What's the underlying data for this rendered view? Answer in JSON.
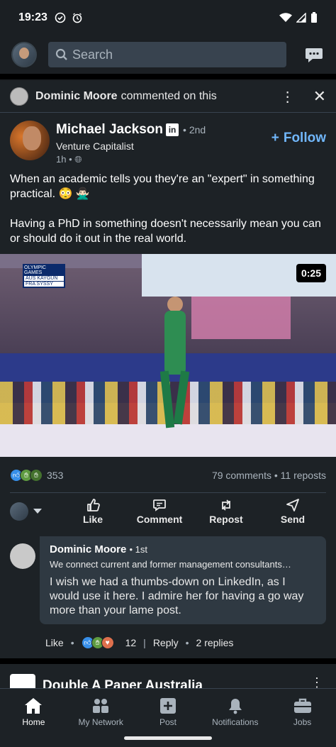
{
  "status": {
    "time": "19:23"
  },
  "search": {
    "placeholder": "Search"
  },
  "context": {
    "actor": "Dominic Moore",
    "action": "commented on this"
  },
  "post": {
    "author": "Michael Jackson",
    "degree": "• 2nd",
    "headline": "Venture Capitalist",
    "time": "1h •",
    "follow_label": "Follow",
    "text_p1": "When an academic tells you they're an \"expert\" in something practical. 😳 🙅🏻‍♂️",
    "text_p2": "Having a PhD in something doesn't necessarily mean you can or should do it out in the real world.",
    "video_duration": "0:25",
    "video_caption_top": "OLYMPIC GAMES",
    "video_row1": "AUS KAYGUN",
    "video_row2": "FRA SYSSY"
  },
  "social": {
    "reactions": "353",
    "comments_reposts": "79 comments • 11 reposts"
  },
  "actions": {
    "like": "Like",
    "comment": "Comment",
    "repost": "Repost",
    "send": "Send"
  },
  "comment": {
    "name": "Dominic Moore",
    "degree": "• 1st",
    "headline": "We connect current and former management consultants…",
    "text": "I wish we had a thumbs-down on LinkedIn, as I would use it here.    I admire her for having a go way more than your lame post.",
    "like": "Like",
    "reactions": "12",
    "reply": "Reply",
    "replies": "2 replies"
  },
  "next_post": {
    "name": "Double A Paper Australia"
  },
  "nav": {
    "home": "Home",
    "network": "My Network",
    "post": "Post",
    "notifications": "Notifications",
    "jobs": "Jobs"
  },
  "colors": {
    "accent": "#71b7fb",
    "background": "#1b1f23",
    "card": "#1d2226"
  }
}
